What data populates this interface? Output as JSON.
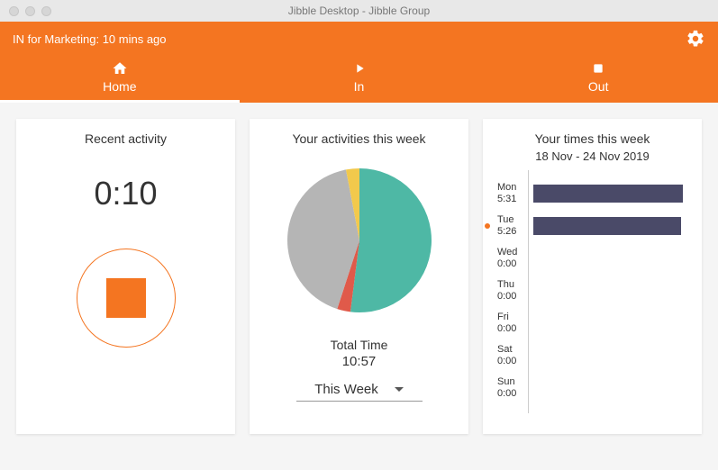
{
  "window": {
    "title": "Jibble Desktop - Jibble Group"
  },
  "header": {
    "status_text": "IN for Marketing: 10 mins ago",
    "tabs": {
      "home": "Home",
      "in": "In",
      "out": "Out"
    }
  },
  "recent_activity": {
    "title": "Recent activity",
    "timer": "0:10"
  },
  "activities": {
    "title": "Your activities this week",
    "total_time_label": "Total Time",
    "total_time_value": "10:57",
    "dropdown_selected": "This Week"
  },
  "times": {
    "title": "Your times this week",
    "subtitle": "18 Nov - 24 Nov 2019",
    "days": [
      {
        "day": "Mon",
        "time": "5:31",
        "is_live": false
      },
      {
        "day": "Tue",
        "time": "5:26",
        "is_live": true
      },
      {
        "day": "Wed",
        "time": "0:00",
        "is_live": false
      },
      {
        "day": "Thu",
        "time": "0:00",
        "is_live": false
      },
      {
        "day": "Fri",
        "time": "0:00",
        "is_live": false
      },
      {
        "day": "Sat",
        "time": "0:00",
        "is_live": false
      },
      {
        "day": "Sun",
        "time": "0:00",
        "is_live": false
      }
    ]
  },
  "chart_data": {
    "pie": {
      "type": "pie",
      "title": "Your activities this week",
      "total": "10:57",
      "series": [
        {
          "name": "Teal",
          "value": 52,
          "color": "#4eb8a5"
        },
        {
          "name": "Red",
          "value": 3,
          "color": "#e05a4a"
        },
        {
          "name": "Gray",
          "value": 42,
          "color": "#b5b5b5"
        },
        {
          "name": "Yellow",
          "value": 3,
          "color": "#f2c94c"
        }
      ]
    },
    "bars": {
      "type": "bar",
      "title": "Your times this week",
      "subtitle": "18 Nov - 24 Nov 2019",
      "categories": [
        "Mon",
        "Tue",
        "Wed",
        "Thu",
        "Fri",
        "Sat",
        "Sun"
      ],
      "values_text": [
        "5:31",
        "5:26",
        "0:00",
        "0:00",
        "0:00",
        "0:00",
        "0:00"
      ],
      "values_minutes": [
        331,
        326,
        0,
        0,
        0,
        0,
        0
      ],
      "xlabel": "",
      "ylabel": "",
      "xlim": [
        0,
        340
      ]
    }
  }
}
